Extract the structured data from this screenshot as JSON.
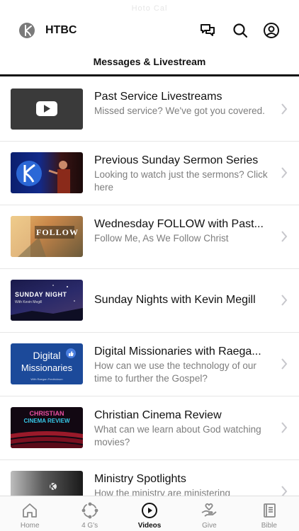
{
  "status": {
    "carrier": "Hoto Cal"
  },
  "header": {
    "app_name": "HTBC"
  },
  "section": {
    "title": "Messages & Livestream"
  },
  "items": [
    {
      "title": "Past Service Livestreams",
      "subtitle": "Missed service? We've got you covered."
    },
    {
      "title": "Previous Sunday Sermon Series",
      "subtitle": "Looking to watch just the sermons? Click here"
    },
    {
      "title": "Wednesday FOLLOW with Past...",
      "subtitle": "Follow Me, As We Follow Christ",
      "thumb_text": "FOLLOW"
    },
    {
      "title": "Sunday Nights with Kevin Megill",
      "subtitle": "",
      "thumb_text": "SUNDAY NIGHT",
      "thumb_sub": "With Kevin Megill"
    },
    {
      "title": "Digital Missionaries with Raega...",
      "subtitle": "How can we use the technology of our time to further the Gospel?",
      "thumb_text_1": "Digital",
      "thumb_text_2": "Missionaries",
      "thumb_sub": "With Raegan Fredrickson"
    },
    {
      "title": "Christian Cinema Review",
      "subtitle": "What can we learn about God watching movies?",
      "thumb_text_1": "CHRISTIAN",
      "thumb_text_2": "CINEMA REVIEW"
    },
    {
      "title": "Ministry Spotlights",
      "subtitle": "How the ministry are ministering"
    }
  ],
  "tabs": [
    {
      "label": "Home",
      "icon": "home-icon"
    },
    {
      "label": "4 G's",
      "icon": "cycle-icon"
    },
    {
      "label": "Videos",
      "icon": "play-circle-icon",
      "active": true
    },
    {
      "label": "Give",
      "icon": "give-hand-heart-icon"
    },
    {
      "label": "Bible",
      "icon": "book-icon"
    }
  ]
}
